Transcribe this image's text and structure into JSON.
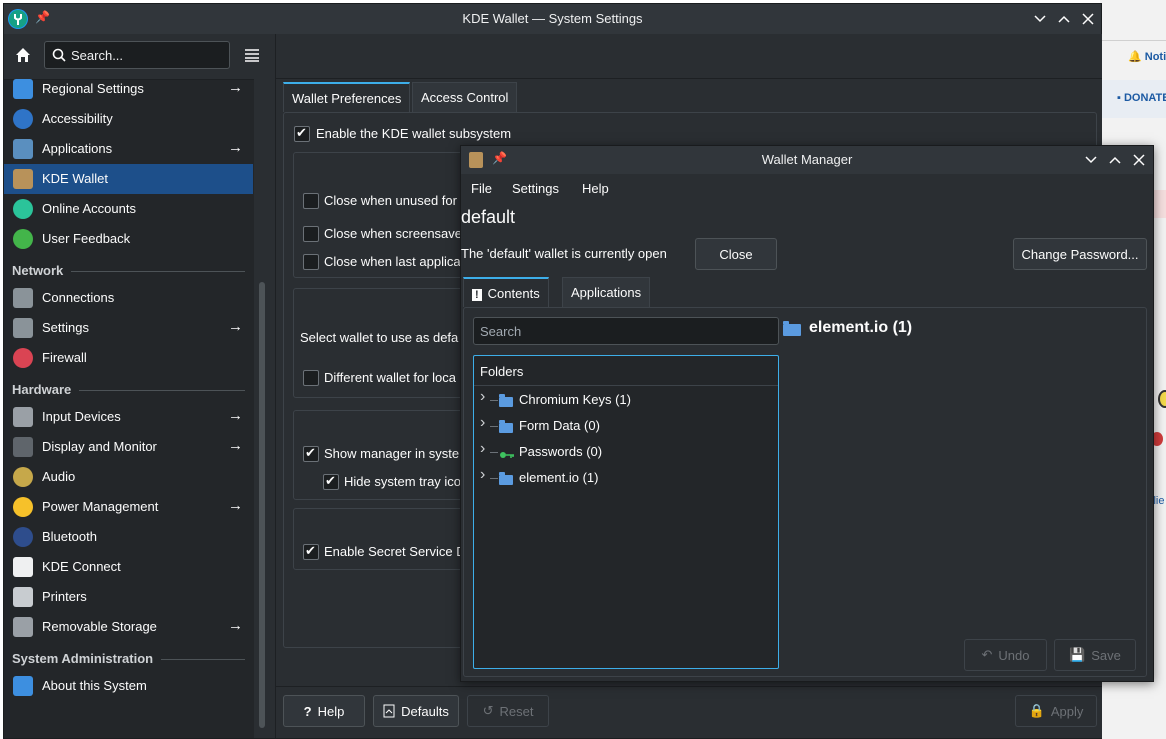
{
  "background": {
    "notification_text": "Noti",
    "donate_text": "DONATE",
    "side_text": "ilie"
  },
  "main_window": {
    "title": "KDE Wallet — System Settings",
    "search_placeholder": "Search...",
    "sidebar": {
      "items_top": [
        {
          "label": "Regional Settings",
          "icon": "regional-icon",
          "color": "#3d8fe0",
          "arrow": true
        },
        {
          "label": "Accessibility",
          "icon": "accessibility-icon",
          "color": "#2f74c7",
          "arrow": false
        },
        {
          "label": "Applications",
          "icon": "applications-icon",
          "color": "#5a8fbf",
          "arrow": true
        },
        {
          "label": "KDE Wallet",
          "icon": "wallet-icon",
          "color": "#b8925a",
          "arrow": false,
          "active": true
        },
        {
          "label": "Online Accounts",
          "icon": "online-accounts-icon",
          "color": "#2bc49a",
          "arrow": false
        },
        {
          "label": "User Feedback",
          "icon": "feedback-icon",
          "color": "#43b54a",
          "arrow": false
        }
      ],
      "section_network": "Network",
      "items_network": [
        {
          "label": "Connections",
          "icon": "connections-icon",
          "color": "#8a9399",
          "arrow": false
        },
        {
          "label": "Settings",
          "icon": "network-settings-icon",
          "color": "#8a9399",
          "arrow": true
        },
        {
          "label": "Firewall",
          "icon": "firewall-icon",
          "color": "#da4453",
          "arrow": false
        }
      ],
      "section_hardware": "Hardware",
      "items_hardware": [
        {
          "label": "Input Devices",
          "icon": "mouse-icon",
          "color": "#9aa0a6",
          "arrow": true
        },
        {
          "label": "Display and Monitor",
          "icon": "display-icon",
          "color": "#5f656b",
          "arrow": true
        },
        {
          "label": "Audio",
          "icon": "audio-icon",
          "color": "#c6a84a",
          "arrow": false
        },
        {
          "label": "Power Management",
          "icon": "power-icon",
          "color": "#f6c12a",
          "arrow": true
        },
        {
          "label": "Bluetooth",
          "icon": "bluetooth-icon",
          "color": "#2e4d8c",
          "arrow": false
        },
        {
          "label": "KDE Connect",
          "icon": "kde-connect-icon",
          "color": "#eff0f1",
          "arrow": false
        },
        {
          "label": "Printers",
          "icon": "printer-icon",
          "color": "#c8ccd0",
          "arrow": false
        },
        {
          "label": "Removable Storage",
          "icon": "storage-icon",
          "color": "#9aa0a6",
          "arrow": true
        }
      ],
      "section_sysadmin": "System Administration",
      "items_sysadmin": [
        {
          "label": "About this System",
          "icon": "info-icon",
          "color": "#3d8fe0",
          "arrow": false
        }
      ]
    },
    "content": {
      "tab_wallet_prefs": "Wallet Preferences",
      "tab_access_control": "Access Control",
      "enable_subsystem": "Enable the KDE wallet subsystem",
      "close_unused": "Close when unused for",
      "close_screensaver": "Close when screensave",
      "close_last_app": "Close when last applica",
      "select_wallet": "Select wallet to use as defa",
      "different_wallet": "Different wallet for loca",
      "show_manager": "Show manager in syste",
      "hide_tray": "Hide system tray ico",
      "enable_secret": "Enable Secret Service D"
    },
    "footer": {
      "help": "Help",
      "defaults": "Defaults",
      "reset": "Reset",
      "apply": "Apply"
    }
  },
  "wallet_manager": {
    "title": "Wallet Manager",
    "menu": [
      "File",
      "Settings",
      "Help"
    ],
    "wallet_name": "default",
    "status": "The 'default' wallet is currently open",
    "close_button": "Close",
    "change_password_button": "Change Password...",
    "tab_contents": "Contents",
    "tab_applications": "Applications",
    "search_placeholder": "Search",
    "folders_header": "Folders",
    "folders": [
      {
        "label": "Chromium Keys (1)",
        "icon": "folder-icon"
      },
      {
        "label": "Form Data (0)",
        "icon": "folder-icon"
      },
      {
        "label": "Passwords (0)",
        "icon": "key-icon"
      },
      {
        "label": "element.io (1)",
        "icon": "folder-icon"
      }
    ],
    "selected_folder": "element.io (1)",
    "undo_button": "Undo",
    "save_button": "Save"
  }
}
